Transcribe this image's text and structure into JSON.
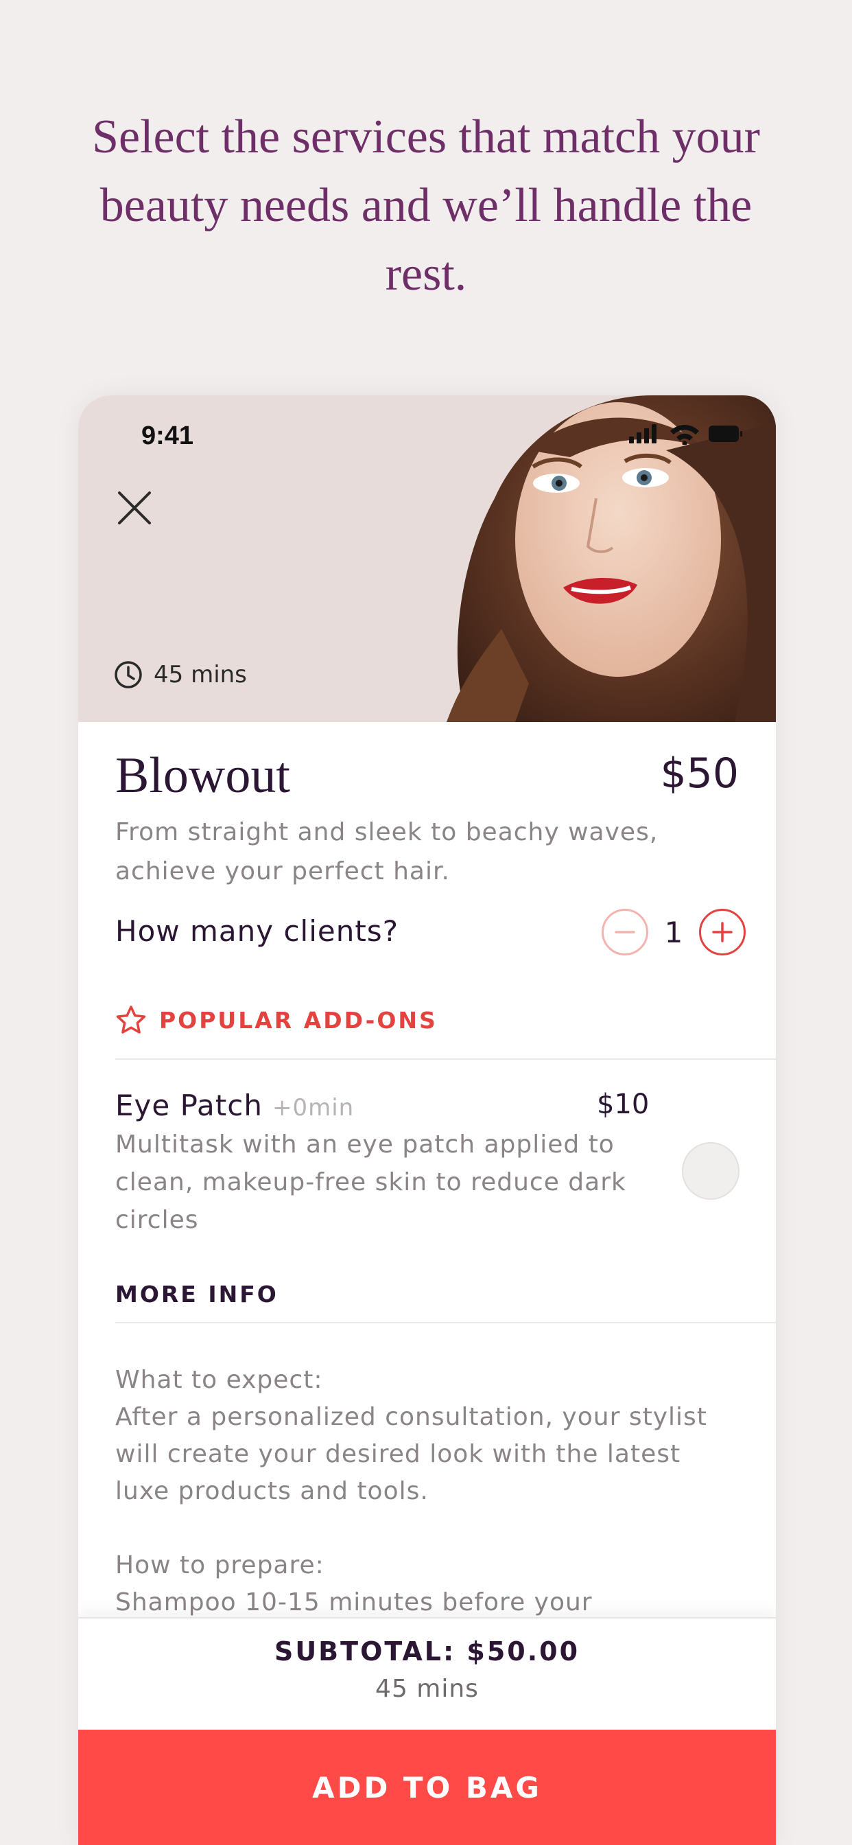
{
  "headline": "Select the services that match your beauty needs and we’ll handle the rest.",
  "status_bar": {
    "time": "9:41"
  },
  "service": {
    "duration": "45 mins",
    "title": "Blowout",
    "price": "$50",
    "description": "From straight and sleek to beachy waves, achieve your perfect hair."
  },
  "clients": {
    "label": "How many clients?",
    "count": "1"
  },
  "popular_addons": {
    "label": "POPULAR ADD-ONS",
    "items": [
      {
        "name": "Eye Patch",
        "time": "+0min",
        "price": "$10",
        "description": "Multitask with an eye patch applied to clean, makeup-free skin to reduce dark circles",
        "selected": false
      }
    ]
  },
  "more_info": {
    "label": "MORE INFO",
    "expect_title": "What to expect:",
    "expect_text": "After a personalized consultation, your stylist will create your desired look with the latest luxe products and tools.",
    "prepare_title": "How to prepare:",
    "prepare_text": "Shampoo 10-15 minutes before your"
  },
  "footer": {
    "subtotal": "SUBTOTAL: $50.00",
    "total_time": "45 mins",
    "add_button": "ADD TO BAG"
  },
  "colors": {
    "background": "#f2eeed",
    "headline": "#6e2f68",
    "accent": "#ff4a47",
    "dark_text": "#2b1734"
  },
  "icons": [
    "close-icon",
    "clock-icon",
    "minus-icon",
    "plus-icon",
    "star-icon",
    "signal-icon",
    "wifi-icon",
    "battery-icon"
  ]
}
